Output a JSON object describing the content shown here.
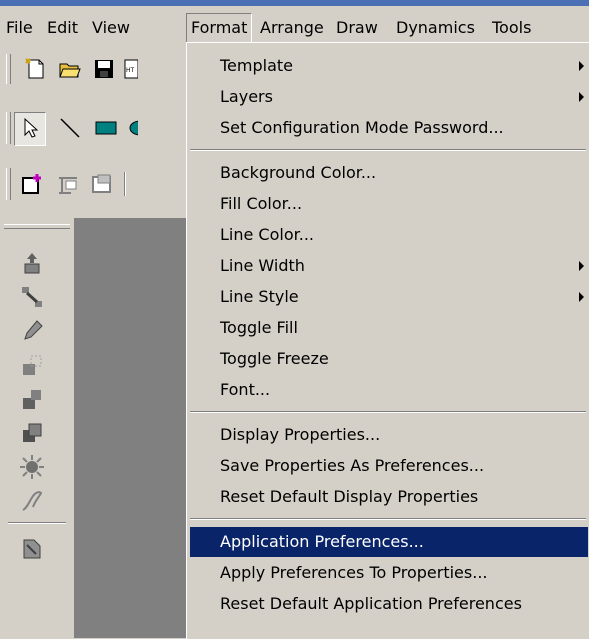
{
  "menubar": {
    "items": [
      "File",
      "Edit",
      "View",
      "Format",
      "Arrange",
      "Draw",
      "Dynamics",
      "Tools"
    ]
  },
  "format_menu": {
    "groups": [
      [
        {
          "label": "Template",
          "submenu": true
        },
        {
          "label": "Layers",
          "submenu": true
        },
        {
          "label": "Set Configuration Mode Password...",
          "submenu": false
        }
      ],
      [
        {
          "label": "Background Color...",
          "submenu": false
        },
        {
          "label": "Fill Color...",
          "submenu": false
        },
        {
          "label": "Line Color...",
          "submenu": false
        },
        {
          "label": "Line Width",
          "submenu": true
        },
        {
          "label": "Line Style",
          "submenu": true
        },
        {
          "label": "Toggle Fill",
          "submenu": false
        },
        {
          "label": "Toggle Freeze",
          "submenu": false
        },
        {
          "label": "Font...",
          "submenu": false
        }
      ],
      [
        {
          "label": "Display Properties...",
          "submenu": false
        },
        {
          "label": "Save Properties As Preferences...",
          "submenu": false
        },
        {
          "label": "Reset Default Display Properties",
          "submenu": false
        }
      ],
      [
        {
          "label": "Application Preferences...",
          "submenu": false,
          "highlighted": true
        },
        {
          "label": "Apply Preferences To Properties...",
          "submenu": false
        },
        {
          "label": "Reset Default Application Preferences",
          "submenu": false
        }
      ]
    ]
  },
  "colors": {
    "highlight": "#0a246a",
    "face": "#d4d0c8",
    "workspace": "#808080"
  }
}
